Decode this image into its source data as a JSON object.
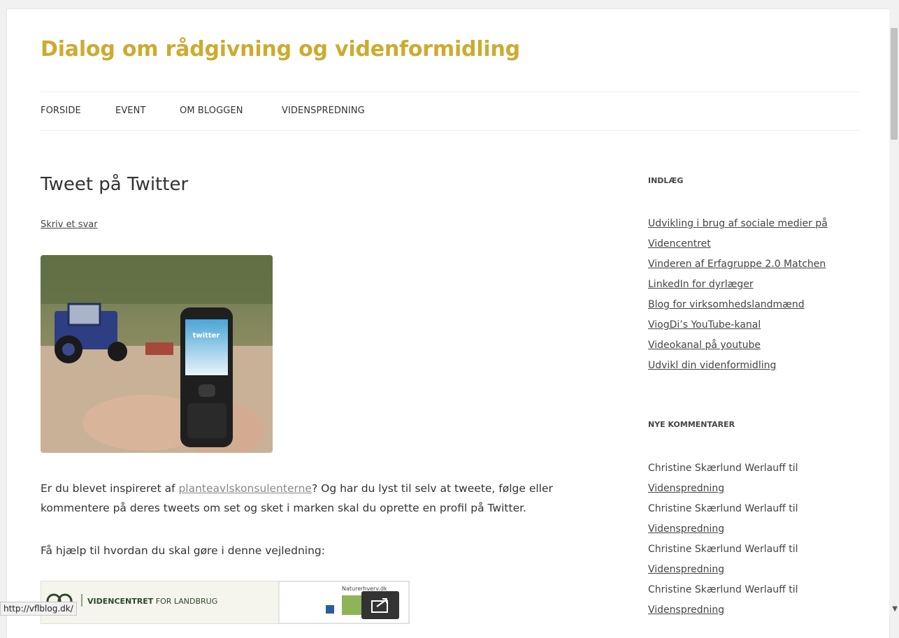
{
  "site": {
    "title": "Dialog om rådgivning og videnformidling",
    "title_color": "#ccab30"
  },
  "nav": {
    "items": [
      {
        "label": "FORSIDE"
      },
      {
        "label": "EVENT"
      },
      {
        "label": "OM BLOGGEN"
      },
      {
        "label": "VIDENSPREDNING"
      }
    ]
  },
  "post": {
    "title": "Tweet på Twitter",
    "reply_link": "Skriv et svar",
    "p1_before": "Er du blevet inspireret af ",
    "p1_link": "planteavlskonsulenterne",
    "p1_after_line1": "? Og har du lyst til selv at tweete, følge eller",
    "p1_line2": "kommentere på deres tweets om set og sket i marken skal du oprette en profil på Twitter.",
    "p2": "Få hjælp til hvordan du skal gøre i denne vejledning:",
    "vejledning_logo_text_bold": "VIDENCENTRET",
    "vejledning_logo_text": " FOR LANDBRUG",
    "vejledning_right_text": "Naturerhverv.dk",
    "phone_screen_text": "twitter"
  },
  "sidebar": {
    "posts_title": "INDLÆG",
    "posts": [
      "Udvikling i brug af sociale medier på",
      "Videncentret",
      "Vinderen af Erfagruppe 2.0 Matchen",
      "LinkedIn for dyrlæger",
      "Blog for virksomhedslandmænd",
      "ViogDi’s YouTube-kanal",
      "Videokanal på youtube",
      "Udvikl din videnformidling"
    ],
    "comments_title": "NYE KOMMENTARER",
    "comments": [
      {
        "author": "Christine Skærlund Werlauff til",
        "post": "Videnspredning"
      },
      {
        "author": "Christine Skærlund Werlauff til",
        "post": "Videnspredning"
      },
      {
        "author": "Christine Skærlund Werlauff til",
        "post": "Videnspredning"
      },
      {
        "author": "Christine Skærlund Werlauff til",
        "post": "Videnspredning"
      }
    ]
  },
  "status_bar": {
    "url": "http://vflblog.dk/"
  }
}
